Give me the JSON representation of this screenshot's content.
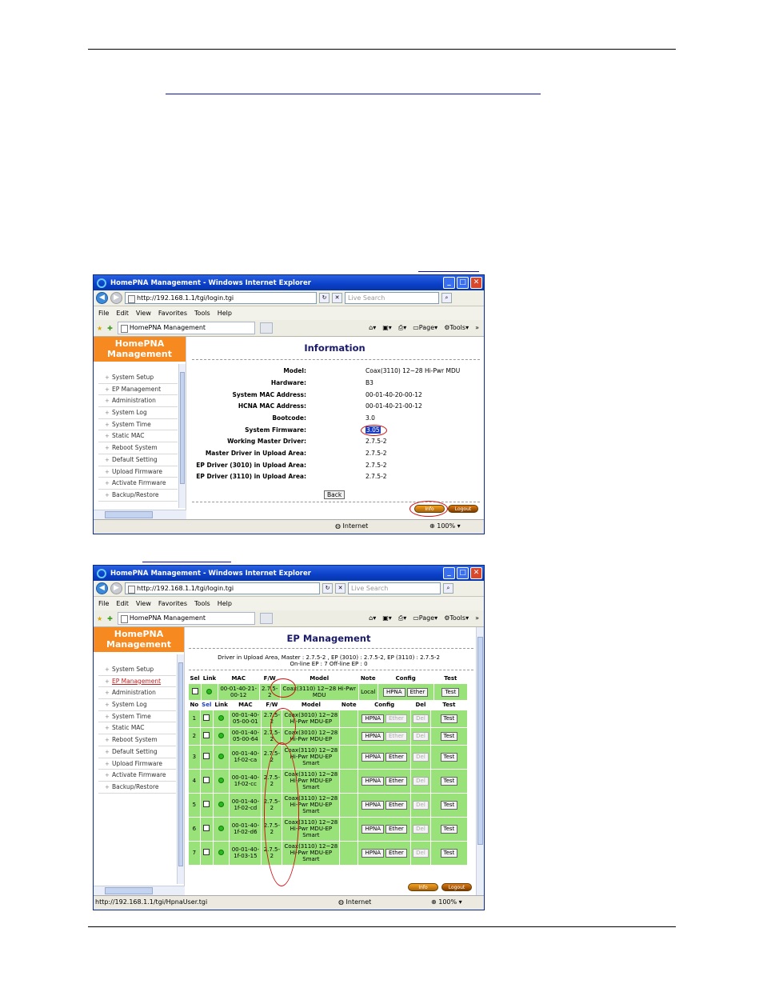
{
  "browser": {
    "title": "HomePNA Management - Windows Internet Explorer",
    "url": "http://192.168.1.1/tgi/login.tgi",
    "search_placeholder": "Live Search",
    "menu": [
      "File",
      "Edit",
      "View",
      "Favorites",
      "Tools",
      "Help"
    ],
    "tab_title": "HomePNA Management",
    "toolbar_page": "Page",
    "toolbar_tools": "Tools",
    "status_zone": "Internet",
    "zoom": "100%"
  },
  "brand": "HomePNA Management",
  "sidebar_items": [
    "System Setup",
    "EP Management",
    "Administration",
    "System Log",
    "System Time",
    "Static MAC",
    "Reboot System",
    "Default Setting",
    "Upload Firmware",
    "Activate Firmware",
    "Backup/Restore"
  ],
  "info_page": {
    "title": "Information",
    "rows": [
      {
        "label": "Model:",
        "value": "Coax(3110) 12~28 Hi-Pwr MDU"
      },
      {
        "label": "Hardware:",
        "value": "B3"
      },
      {
        "label": "System MAC Address:",
        "value": "00-01-40-20-00-12"
      },
      {
        "label": "HCNA MAC Address:",
        "value": "00-01-40-21-00-12"
      },
      {
        "label": "Bootcode:",
        "value": "3.0"
      },
      {
        "label": "System Firmware:",
        "value": "3.05"
      },
      {
        "label": "Working Master Driver:",
        "value": "2.7.5-2"
      },
      {
        "label": "Master Driver in Upload Area:",
        "value": "2.7.5-2"
      },
      {
        "label": "EP Driver (3010) in Upload Area:",
        "value": "2.7.5-2"
      },
      {
        "label": "EP Driver (3110) in Upload Area:",
        "value": "2.7.5-2"
      }
    ],
    "back_label": "Back",
    "info_label": "Info",
    "logout_label": "Logout"
  },
  "ep_page": {
    "url": "http://192.168.1.1/tgi/login.tgi",
    "status_url": "http://192.168.1.1/tgi/HpnaUser.tgi",
    "title": "EP Management",
    "summary_line1": "Driver in Upload Area, Master : 2.7.5-2 ,  EP (3010) : 2.7.5-2,  EP (3110) : 2.7.5-2",
    "summary_line2": "On-line EP : 7     Off-line EP : 0",
    "master_headers": [
      "Sel",
      "Link",
      "MAC",
      "F/W",
      "Model",
      "Note",
      "Config",
      "Test"
    ],
    "master_row": {
      "mac": "00-01-40-21-00-12",
      "fw": "2.7.5-2",
      "model": "Coax(3110) 12~28 Hi-Pwr MDU",
      "note": "Local",
      "cfg1": "HPNA",
      "cfg2": "Ether",
      "test": "Test"
    },
    "ep_headers": [
      "No",
      "Sel",
      "Link",
      "MAC",
      "F/W",
      "Model",
      "Note",
      "Config",
      "Del",
      "Test"
    ],
    "ep_rows": [
      {
        "no": "1",
        "mac": "00-01-40-05-00-01",
        "fw": "2.7.5-2",
        "model": "Coax(3010) 12~28 Hi-Pwr MDU-EP",
        "cfg1": "HPNA",
        "cfg2": "Ether",
        "del": "Del",
        "test": "Test"
      },
      {
        "no": "2",
        "mac": "00-01-40-05-00-64",
        "fw": "2.7.5-2",
        "model": "Coax(3010) 12~28 Hi-Pwr MDU-EP",
        "cfg1": "HPNA",
        "cfg2": "Ether",
        "del": "Del",
        "test": "Test"
      },
      {
        "no": "3",
        "mac": "00-01-40-1f-02-ca",
        "fw": "2.7.5-2",
        "model": "Coax(3110) 12~28 Hi-Pwr MDU-EP Smart",
        "cfg1": "HPNA",
        "cfg2": "Ether",
        "del": "Del",
        "test": "Test"
      },
      {
        "no": "4",
        "mac": "00-01-40-1f-02-cc",
        "fw": "2.7.5-2",
        "model": "Coax(3110) 12~28 Hi-Pwr MDU-EP Smart",
        "cfg1": "HPNA",
        "cfg2": "Ether",
        "del": "Del",
        "test": "Test"
      },
      {
        "no": "5",
        "mac": "00-01-40-1f-02-cd",
        "fw": "2.7.5-2",
        "model": "Coax(3110) 12~28 Hi-Pwr MDU-EP Smart",
        "cfg1": "HPNA",
        "cfg2": "Ether",
        "del": "Del",
        "test": "Test"
      },
      {
        "no": "6",
        "mac": "00-01-40-1f-02-d6",
        "fw": "2.7.5-2",
        "model": "Coax(3110) 12~28 Hi-Pwr MDU-EP Smart",
        "cfg1": "HPNA",
        "cfg2": "Ether",
        "del": "Del",
        "test": "Test"
      },
      {
        "no": "7",
        "mac": "00-01-40-1f-03-15",
        "fw": "2.7.5-2",
        "model": "Coax(3110) 12~28 Hi-Pwr MDU-EP Smart",
        "cfg1": "HPNA",
        "cfg2": "Ether",
        "del": "Del",
        "test": "Test"
      }
    ]
  }
}
